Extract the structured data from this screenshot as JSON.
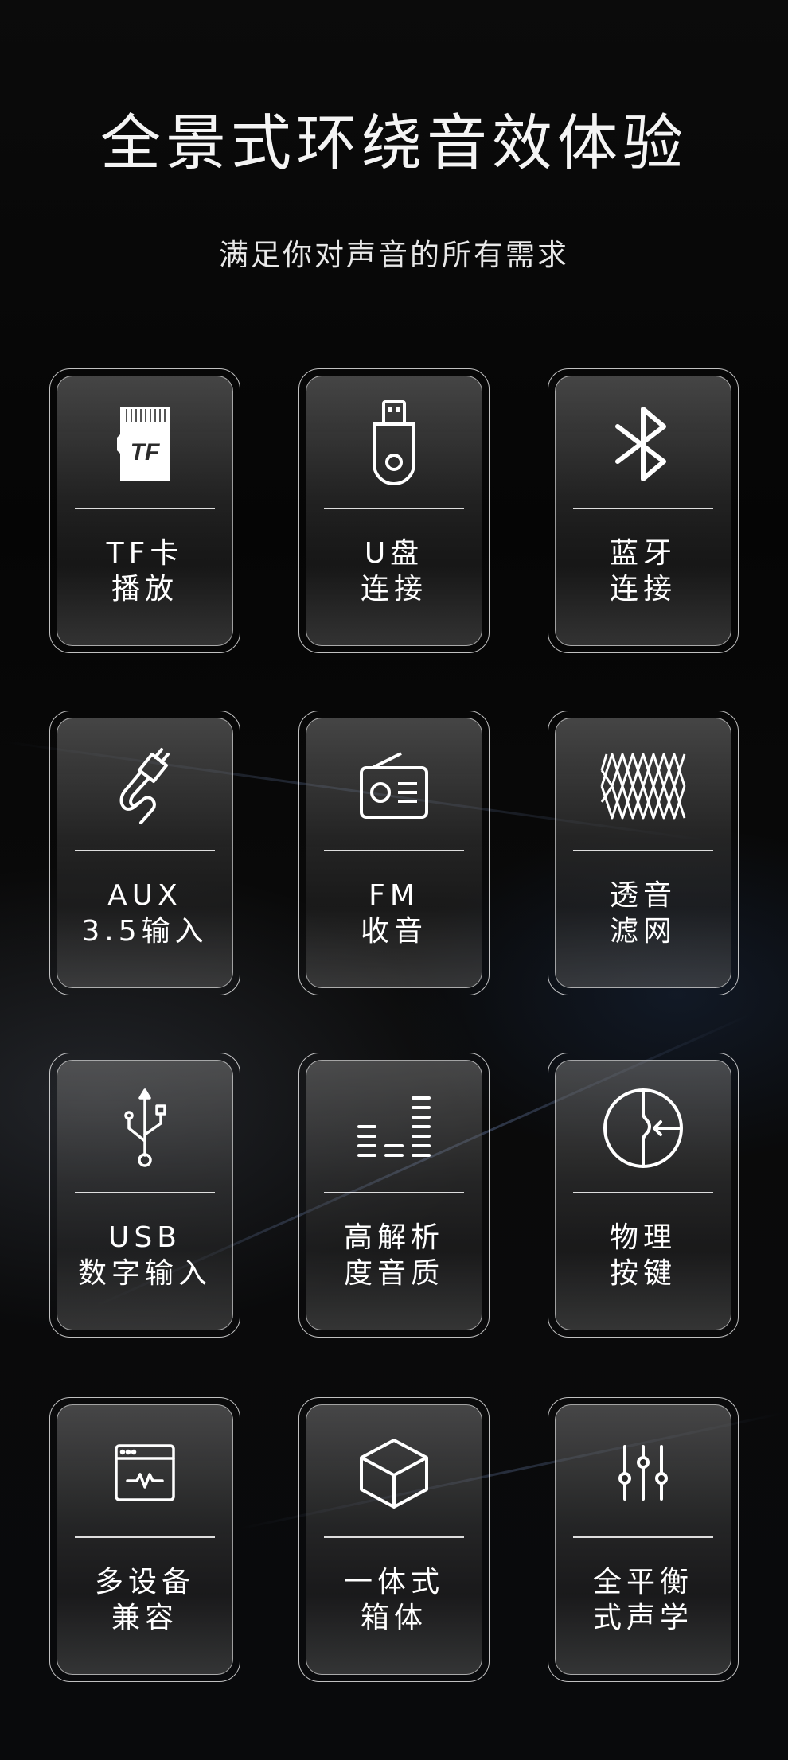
{
  "header": {
    "title": "全景式环绕音效体验",
    "subtitle": "满足你对声音的所有需求"
  },
  "features": [
    {
      "icon": "tf-card-icon",
      "line1": "TF卡",
      "line2": "播放"
    },
    {
      "icon": "usb-drive-icon",
      "line1": "U盘",
      "line2": "连接"
    },
    {
      "icon": "bluetooth-icon",
      "line1": "蓝牙",
      "line2": "连接"
    },
    {
      "icon": "aux-cable-icon",
      "line1": "AUX",
      "line2": "3.5输入"
    },
    {
      "icon": "radio-icon",
      "line1": "FM",
      "line2": "收音"
    },
    {
      "icon": "mesh-grille-icon",
      "line1": "透音",
      "line2": "滤网"
    },
    {
      "icon": "usb-symbol-icon",
      "line1": "USB",
      "line2": "数字输入"
    },
    {
      "icon": "equalizer-bars-icon",
      "line1": "高解析",
      "line2": "度音质"
    },
    {
      "icon": "physical-button-icon",
      "line1": "物理",
      "line2": "按键"
    },
    {
      "icon": "device-window-icon",
      "line1": "多设备",
      "line2": "兼容"
    },
    {
      "icon": "cube-icon",
      "line1": "一体式",
      "line2": "箱体"
    },
    {
      "icon": "sliders-icon",
      "line1": "全平衡",
      "line2": "式声学"
    }
  ],
  "card_text": {
    "tf_logo": "TF"
  }
}
